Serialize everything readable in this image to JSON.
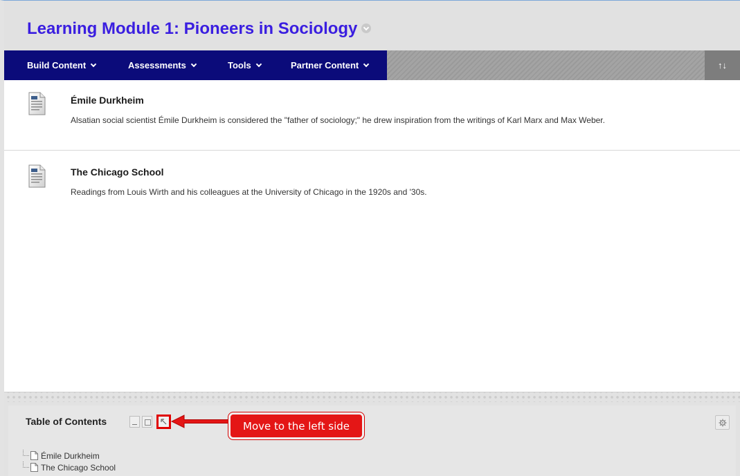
{
  "page": {
    "title": "Learning Module 1: Pioneers in Sociology"
  },
  "menubar": {
    "items": [
      {
        "label": "Build Content"
      },
      {
        "label": "Assessments"
      },
      {
        "label": "Tools"
      },
      {
        "label": "Partner Content"
      }
    ],
    "sort_label": "↑↓"
  },
  "content": {
    "items": [
      {
        "title": "Émile Durkheim",
        "description": "Alsatian social scientist Émile Durkheim is considered the \"father of sociology;\" he drew inspiration from the writings of Karl Marx and Max Weber.",
        "icon": "document-icon"
      },
      {
        "title": "The Chicago School",
        "description": "Readings from Louis Wirth and his colleagues at the University of Chicago in the 1920s and '30s.",
        "icon": "document-icon"
      }
    ]
  },
  "toc": {
    "title": "Table of Contents",
    "items": [
      {
        "label": "Émile Durkheim"
      },
      {
        "label": "The Chicago School"
      }
    ]
  },
  "annotation": {
    "callout_text": "Move to the left side"
  },
  "colors": {
    "title": "#3a1ee0",
    "menubar": "#0b0b7a",
    "callout": "#e41616",
    "highlight_border": "#e00000"
  }
}
